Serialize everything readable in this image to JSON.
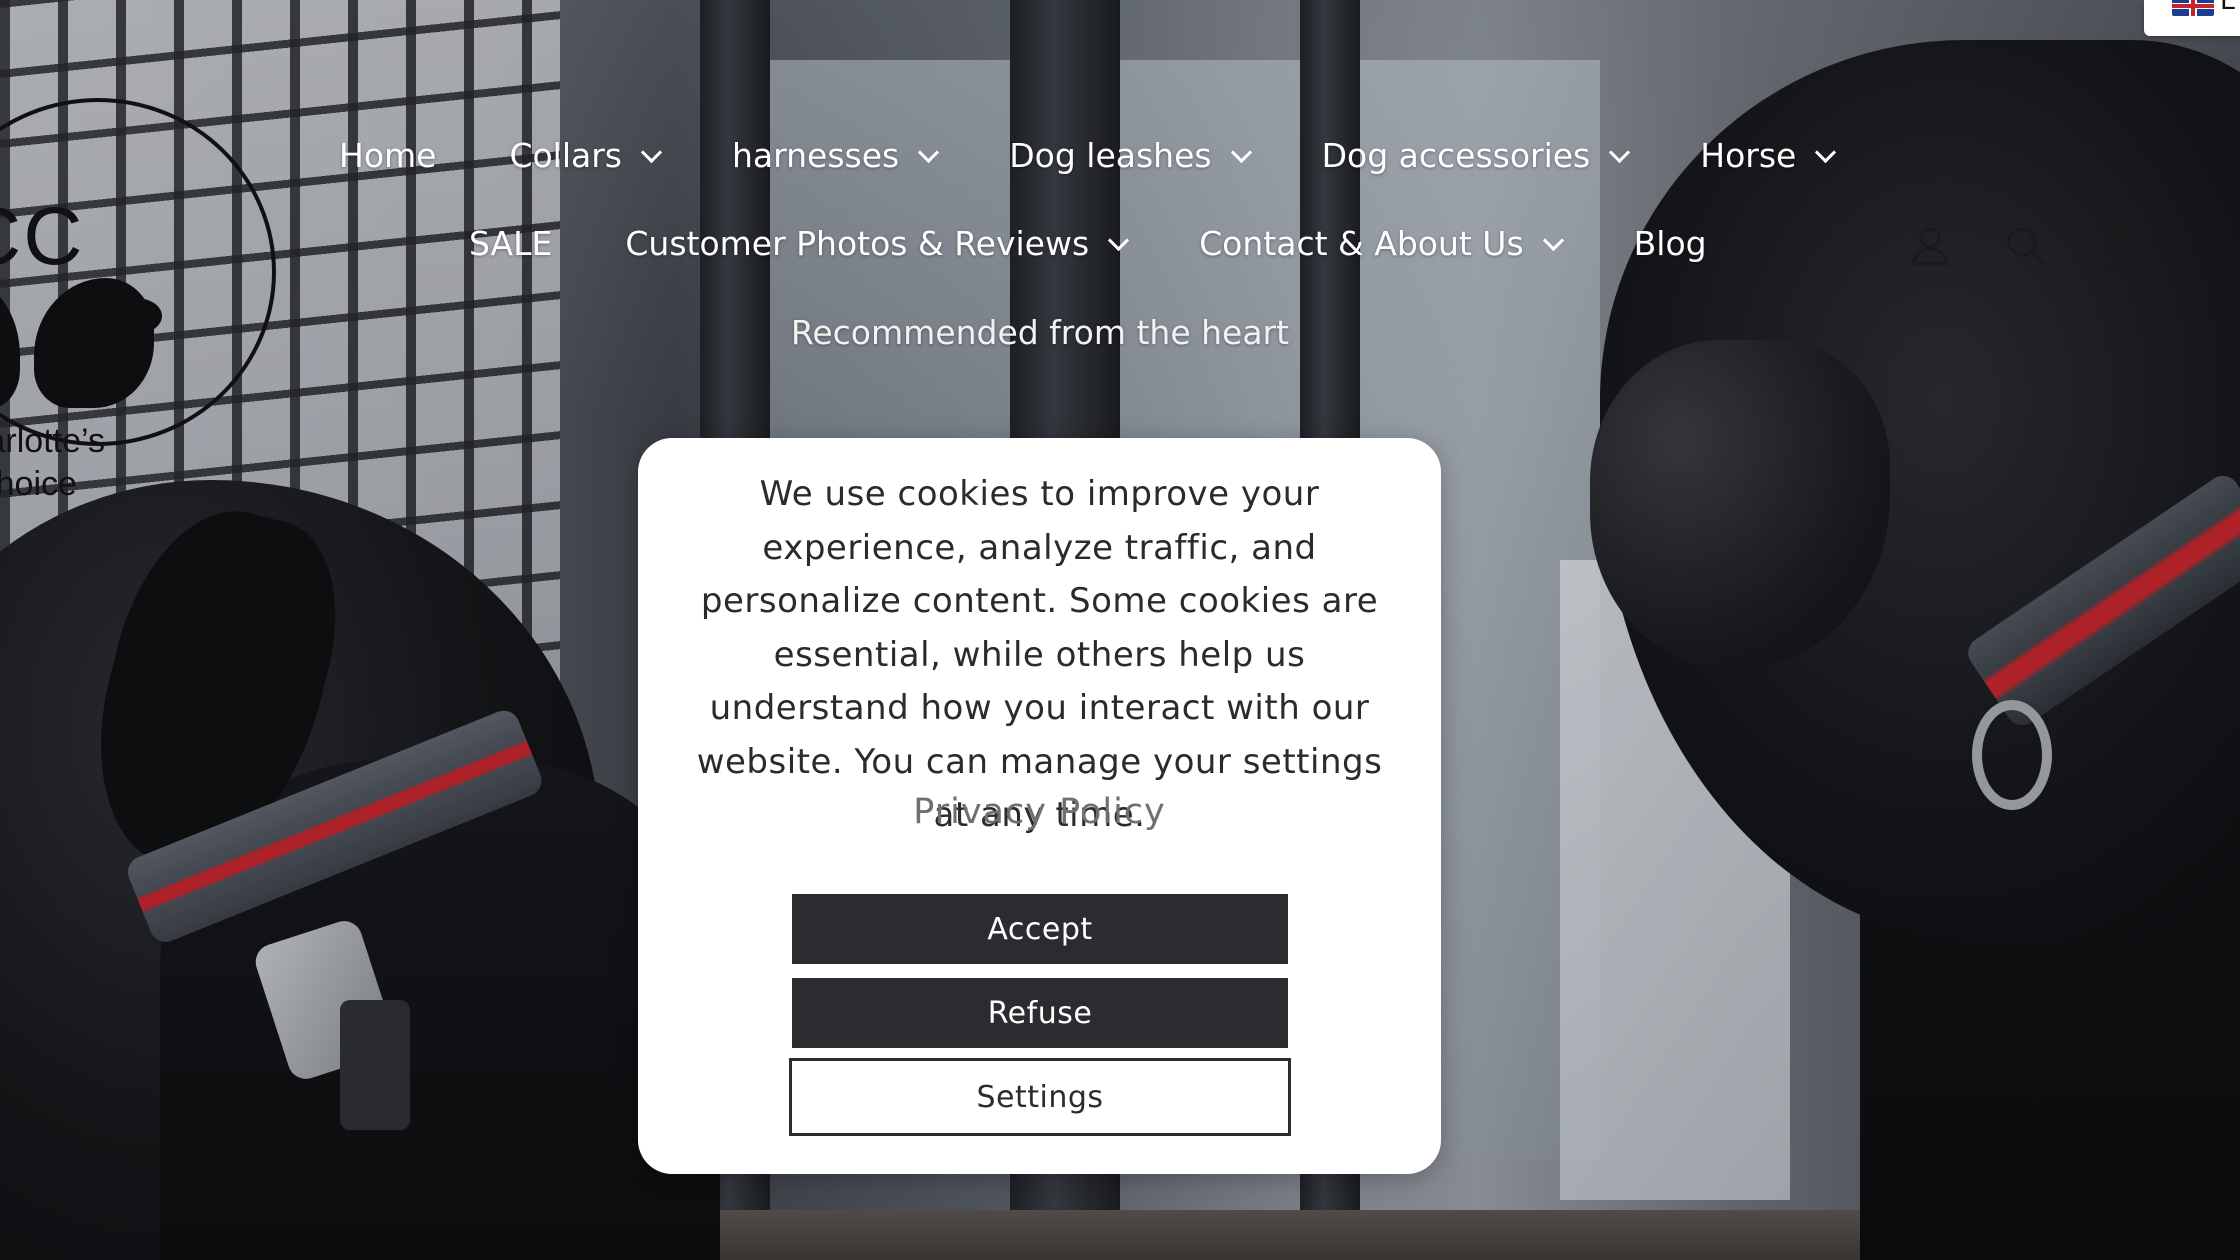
{
  "brand": {
    "logo_mark": "CC",
    "logo_line1": "Charlotte’s",
    "logo_line2": "Choice"
  },
  "nav": {
    "row1": [
      {
        "label": "Home",
        "has_dropdown": false
      },
      {
        "label": "Collars",
        "has_dropdown": true
      },
      {
        "label": "harnesses",
        "has_dropdown": true
      },
      {
        "label": "Dog leashes",
        "has_dropdown": true
      },
      {
        "label": "Dog accessories",
        "has_dropdown": true
      },
      {
        "label": "Horse",
        "has_dropdown": true
      }
    ],
    "row2": [
      {
        "label": "SALE",
        "has_dropdown": false
      },
      {
        "label": "Customer Photos & Reviews",
        "has_dropdown": true
      },
      {
        "label": "Contact & About Us",
        "has_dropdown": true
      },
      {
        "label": "Blog",
        "has_dropdown": false
      }
    ]
  },
  "tagline": "Recommended from the heart",
  "header_icons": [
    "account-icon",
    "search-icon",
    "cart-icon"
  ],
  "language": {
    "flag": "uk-flag-icon",
    "code": "E"
  },
  "cookie_banner": {
    "message": "We use cookies to improve your experience, analyze traffic, and personalize content. Some cookies are essential, while others help us understand how you interact with our website. You can manage your settings at any time.",
    "privacy_link": "Privacy Policy",
    "accept_label": "Accept",
    "refuse_label": "Refuse",
    "settings_label": "Settings"
  },
  "colors": {
    "button_dark": "#2b2c30",
    "accent_red": "#c8232a",
    "nav_text": "#ffffff"
  }
}
